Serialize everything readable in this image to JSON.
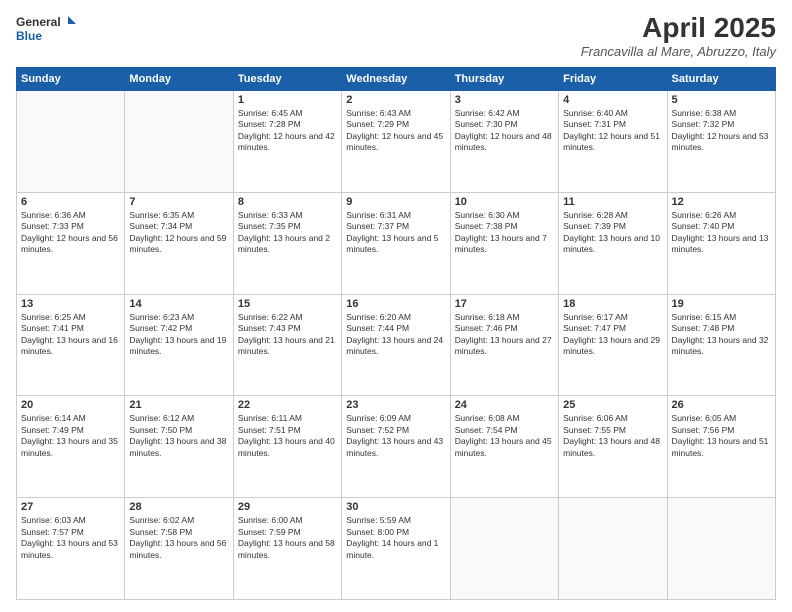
{
  "logo": {
    "line1": "General",
    "line2": "Blue"
  },
  "title": "April 2025",
  "location": "Francavilla al Mare, Abruzzo, Italy",
  "weekdays": [
    "Sunday",
    "Monday",
    "Tuesday",
    "Wednesday",
    "Thursday",
    "Friday",
    "Saturday"
  ],
  "weeks": [
    [
      {
        "day": "",
        "sunrise": "",
        "sunset": "",
        "daylight": ""
      },
      {
        "day": "",
        "sunrise": "",
        "sunset": "",
        "daylight": ""
      },
      {
        "day": "1",
        "sunrise": "Sunrise: 6:45 AM",
        "sunset": "Sunset: 7:28 PM",
        "daylight": "Daylight: 12 hours and 42 minutes."
      },
      {
        "day": "2",
        "sunrise": "Sunrise: 6:43 AM",
        "sunset": "Sunset: 7:29 PM",
        "daylight": "Daylight: 12 hours and 45 minutes."
      },
      {
        "day": "3",
        "sunrise": "Sunrise: 6:42 AM",
        "sunset": "Sunset: 7:30 PM",
        "daylight": "Daylight: 12 hours and 48 minutes."
      },
      {
        "day": "4",
        "sunrise": "Sunrise: 6:40 AM",
        "sunset": "Sunset: 7:31 PM",
        "daylight": "Daylight: 12 hours and 51 minutes."
      },
      {
        "day": "5",
        "sunrise": "Sunrise: 6:38 AM",
        "sunset": "Sunset: 7:32 PM",
        "daylight": "Daylight: 12 hours and 53 minutes."
      }
    ],
    [
      {
        "day": "6",
        "sunrise": "Sunrise: 6:36 AM",
        "sunset": "Sunset: 7:33 PM",
        "daylight": "Daylight: 12 hours and 56 minutes."
      },
      {
        "day": "7",
        "sunrise": "Sunrise: 6:35 AM",
        "sunset": "Sunset: 7:34 PM",
        "daylight": "Daylight: 12 hours and 59 minutes."
      },
      {
        "day": "8",
        "sunrise": "Sunrise: 6:33 AM",
        "sunset": "Sunset: 7:35 PM",
        "daylight": "Daylight: 13 hours and 2 minutes."
      },
      {
        "day": "9",
        "sunrise": "Sunrise: 6:31 AM",
        "sunset": "Sunset: 7:37 PM",
        "daylight": "Daylight: 13 hours and 5 minutes."
      },
      {
        "day": "10",
        "sunrise": "Sunrise: 6:30 AM",
        "sunset": "Sunset: 7:38 PM",
        "daylight": "Daylight: 13 hours and 7 minutes."
      },
      {
        "day": "11",
        "sunrise": "Sunrise: 6:28 AM",
        "sunset": "Sunset: 7:39 PM",
        "daylight": "Daylight: 13 hours and 10 minutes."
      },
      {
        "day": "12",
        "sunrise": "Sunrise: 6:26 AM",
        "sunset": "Sunset: 7:40 PM",
        "daylight": "Daylight: 13 hours and 13 minutes."
      }
    ],
    [
      {
        "day": "13",
        "sunrise": "Sunrise: 6:25 AM",
        "sunset": "Sunset: 7:41 PM",
        "daylight": "Daylight: 13 hours and 16 minutes."
      },
      {
        "day": "14",
        "sunrise": "Sunrise: 6:23 AM",
        "sunset": "Sunset: 7:42 PM",
        "daylight": "Daylight: 13 hours and 19 minutes."
      },
      {
        "day": "15",
        "sunrise": "Sunrise: 6:22 AM",
        "sunset": "Sunset: 7:43 PM",
        "daylight": "Daylight: 13 hours and 21 minutes."
      },
      {
        "day": "16",
        "sunrise": "Sunrise: 6:20 AM",
        "sunset": "Sunset: 7:44 PM",
        "daylight": "Daylight: 13 hours and 24 minutes."
      },
      {
        "day": "17",
        "sunrise": "Sunrise: 6:18 AM",
        "sunset": "Sunset: 7:46 PM",
        "daylight": "Daylight: 13 hours and 27 minutes."
      },
      {
        "day": "18",
        "sunrise": "Sunrise: 6:17 AM",
        "sunset": "Sunset: 7:47 PM",
        "daylight": "Daylight: 13 hours and 29 minutes."
      },
      {
        "day": "19",
        "sunrise": "Sunrise: 6:15 AM",
        "sunset": "Sunset: 7:48 PM",
        "daylight": "Daylight: 13 hours and 32 minutes."
      }
    ],
    [
      {
        "day": "20",
        "sunrise": "Sunrise: 6:14 AM",
        "sunset": "Sunset: 7:49 PM",
        "daylight": "Daylight: 13 hours and 35 minutes."
      },
      {
        "day": "21",
        "sunrise": "Sunrise: 6:12 AM",
        "sunset": "Sunset: 7:50 PM",
        "daylight": "Daylight: 13 hours and 38 minutes."
      },
      {
        "day": "22",
        "sunrise": "Sunrise: 6:11 AM",
        "sunset": "Sunset: 7:51 PM",
        "daylight": "Daylight: 13 hours and 40 minutes."
      },
      {
        "day": "23",
        "sunrise": "Sunrise: 6:09 AM",
        "sunset": "Sunset: 7:52 PM",
        "daylight": "Daylight: 13 hours and 43 minutes."
      },
      {
        "day": "24",
        "sunrise": "Sunrise: 6:08 AM",
        "sunset": "Sunset: 7:54 PM",
        "daylight": "Daylight: 13 hours and 45 minutes."
      },
      {
        "day": "25",
        "sunrise": "Sunrise: 6:06 AM",
        "sunset": "Sunset: 7:55 PM",
        "daylight": "Daylight: 13 hours and 48 minutes."
      },
      {
        "day": "26",
        "sunrise": "Sunrise: 6:05 AM",
        "sunset": "Sunset: 7:56 PM",
        "daylight": "Daylight: 13 hours and 51 minutes."
      }
    ],
    [
      {
        "day": "27",
        "sunrise": "Sunrise: 6:03 AM",
        "sunset": "Sunset: 7:57 PM",
        "daylight": "Daylight: 13 hours and 53 minutes."
      },
      {
        "day": "28",
        "sunrise": "Sunrise: 6:02 AM",
        "sunset": "Sunset: 7:58 PM",
        "daylight": "Daylight: 13 hours and 56 minutes."
      },
      {
        "day": "29",
        "sunrise": "Sunrise: 6:00 AM",
        "sunset": "Sunset: 7:59 PM",
        "daylight": "Daylight: 13 hours and 58 minutes."
      },
      {
        "day": "30",
        "sunrise": "Sunrise: 5:59 AM",
        "sunset": "Sunset: 8:00 PM",
        "daylight": "Daylight: 14 hours and 1 minute."
      },
      {
        "day": "",
        "sunrise": "",
        "sunset": "",
        "daylight": ""
      },
      {
        "day": "",
        "sunrise": "",
        "sunset": "",
        "daylight": ""
      },
      {
        "day": "",
        "sunrise": "",
        "sunset": "",
        "daylight": ""
      }
    ]
  ]
}
